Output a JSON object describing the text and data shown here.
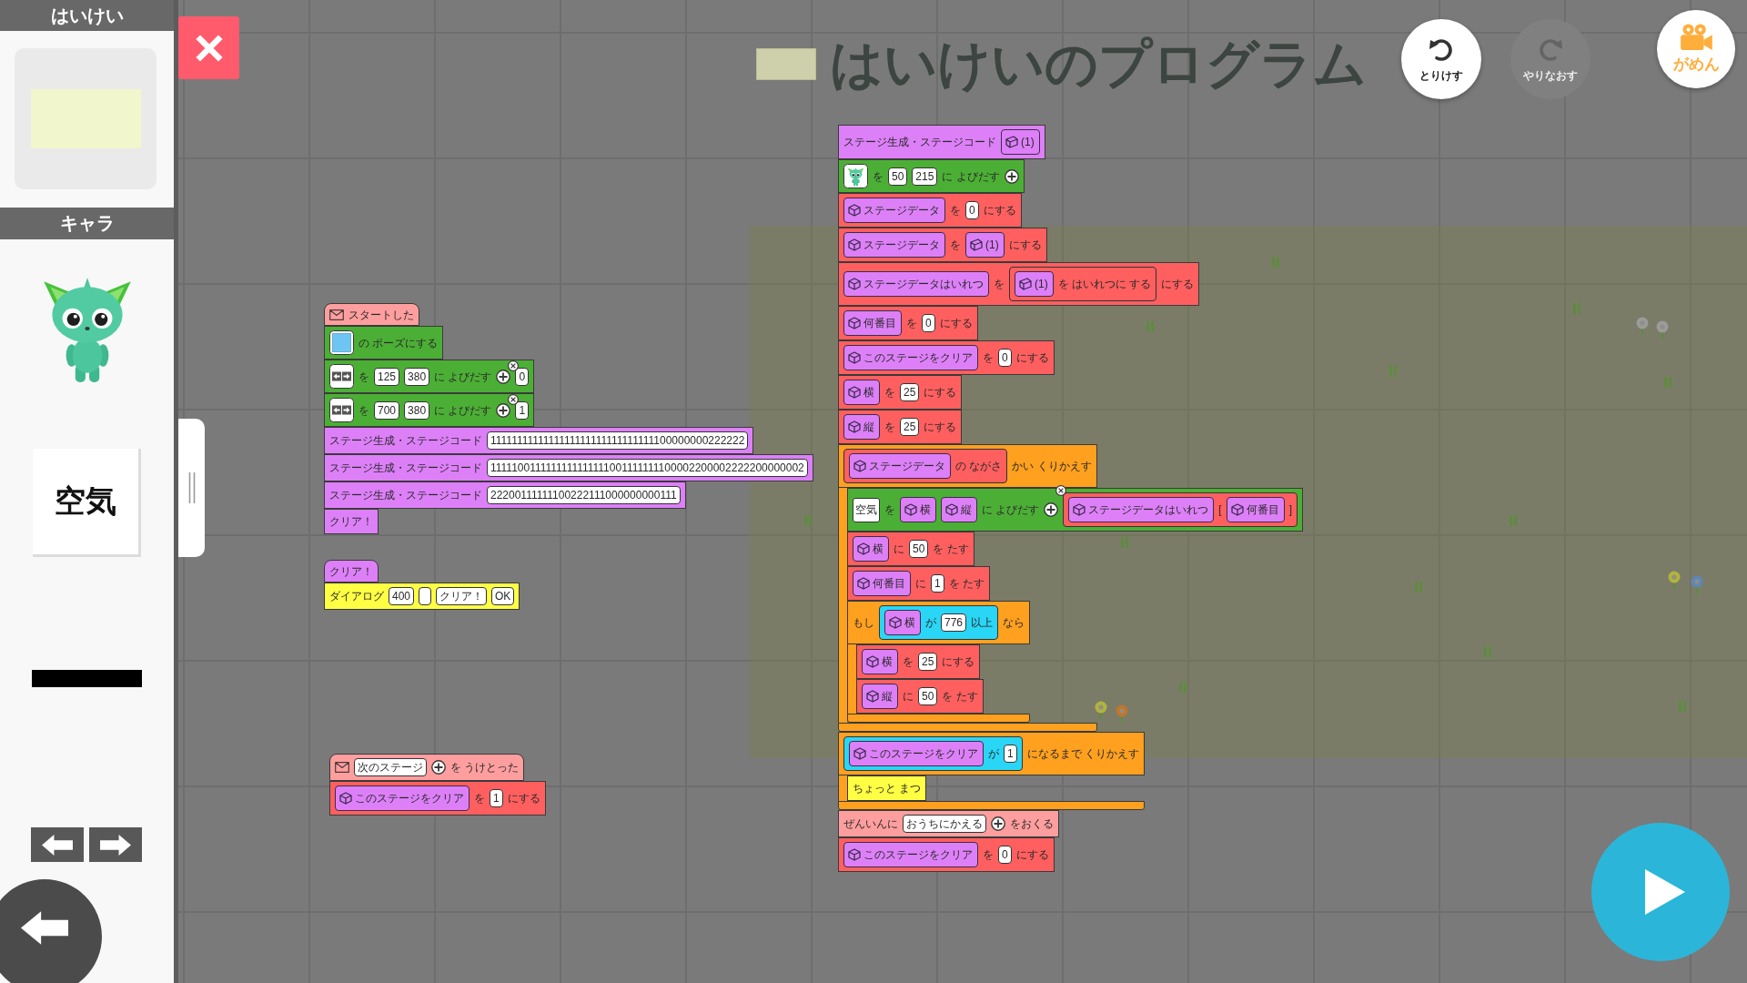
{
  "sidebar": {
    "background": {
      "title": "はいけい"
    },
    "characters": {
      "title": "キャラ",
      "items": [
        {
          "kind": "character"
        },
        {
          "kind": "word",
          "text": "空気"
        },
        {
          "kind": "line"
        }
      ]
    }
  },
  "toolbar": {
    "title": "はいけいのプログラム",
    "buttons": [
      {
        "kind": "undo",
        "label": "とりけす",
        "disabled": false
      },
      {
        "kind": "redo",
        "label": "やりなおす",
        "disabled": true
      }
    ],
    "screen_button": {
      "label": "がめん"
    }
  },
  "scripts": [
    {
      "blocks": [
        {
          "kind": "event",
          "hat": true,
          "parts": [
            {
              "kind": "mail"
            },
            {
              "kind": "text",
              "text": "スタートした"
            }
          ]
        },
        {
          "kind": "sprite",
          "hat": false,
          "parts": [
            {
              "kind": "swatch"
            },
            {
              "kind": "text",
              "text": "の ポーズにする"
            }
          ]
        },
        {
          "kind": "sprite",
          "hat": false,
          "parts": [
            {
              "kind": "arrows"
            },
            {
              "kind": "text",
              "text": "を"
            },
            {
              "kind": "input",
              "value": "125"
            },
            {
              "kind": "input",
              "value": "380"
            },
            {
              "kind": "text",
              "text": "に よびだす"
            },
            {
              "kind": "add"
            },
            {
              "kind": "removable",
              "item": {
                "kind": "input",
                "value": "0"
              }
            }
          ]
        },
        {
          "kind": "sprite",
          "hat": false,
          "parts": [
            {
              "kind": "arrows"
            },
            {
              "kind": "text",
              "text": "を"
            },
            {
              "kind": "input",
              "value": "700"
            },
            {
              "kind": "input",
              "value": "380"
            },
            {
              "kind": "text",
              "text": "に よびだす"
            },
            {
              "kind": "add"
            },
            {
              "kind": "removable",
              "item": {
                "kind": "input",
                "value": "1"
              }
            }
          ]
        },
        {
          "kind": "stage",
          "hat": false,
          "parts": [
            {
              "kind": "text",
              "text": "ステージ生成・ステージコード"
            },
            {
              "kind": "input",
              "value": "1111111111111111111111111111111100000000222222"
            }
          ]
        },
        {
          "kind": "stage",
          "hat": false,
          "parts": [
            {
              "kind": "text",
              "text": "ステージ生成・ステージコード"
            },
            {
              "kind": "input",
              "value": "1111100111111111111111001111111100002200002222200000002"
            }
          ]
        },
        {
          "kind": "stage",
          "hat": false,
          "parts": [
            {
              "kind": "text",
              "text": "ステージ生成・ステージコード"
            },
            {
              "kind": "input",
              "value": "22200111111100222111000000000111"
            }
          ]
        },
        {
          "kind": "stage",
          "hat": false,
          "parts": [
            {
              "kind": "text",
              "text": "クリア！"
            }
          ]
        }
      ]
    },
    {
      "blocks": [
        {
          "kind": "stage",
          "hat": true,
          "parts": [
            {
              "kind": "text",
              "text": "クリア！"
            }
          ]
        },
        {
          "kind": "dialog",
          "hat": false,
          "parts": [
            {
              "kind": "text",
              "text": "ダイアログ"
            },
            {
              "kind": "input",
              "value": "400"
            },
            {
              "kind": "input"
            },
            {
              "kind": "input",
              "value": "クリア！"
            },
            {
              "kind": "input",
              "value": "OK"
            }
          ]
        }
      ]
    },
    {
      "blocks": [
        {
          "kind": "event",
          "hat": true,
          "parts": [
            {
              "kind": "mail"
            },
            {
              "kind": "input",
              "value": "次のステージ"
            },
            {
              "kind": "add"
            },
            {
              "kind": "text",
              "text": "を うけとった"
            }
          ]
        },
        {
          "kind": "variable",
          "hat": false,
          "parts": [
            {
              "kind": "variable",
              "name": "このステージをクリア"
            },
            {
              "kind": "text",
              "text": "を"
            },
            {
              "kind": "input",
              "value": "1"
            },
            {
              "kind": "text",
              "text": "にする"
            }
          ]
        }
      ]
    },
    {
      "blocks": [
        {
          "kind": "stage",
          "hat": false,
          "parts": [
            {
              "kind": "text",
              "text": "ステージ生成・ステージコード"
            },
            {
              "kind": "argument",
              "name": "(1)"
            }
          ]
        },
        {
          "kind": "sprite",
          "hat": false,
          "parts": [
            {
              "kind": "character"
            },
            {
              "kind": "text",
              "text": "を"
            },
            {
              "kind": "input",
              "value": "50"
            },
            {
              "kind": "input",
              "value": "215"
            },
            {
              "kind": "text",
              "text": "に よびだす"
            },
            {
              "kind": "add"
            }
          ]
        },
        {
          "kind": "variable",
          "hat": false,
          "parts": [
            {
              "kind": "variable",
              "name": "ステージデータ"
            },
            {
              "kind": "text",
              "text": "を"
            },
            {
              "kind": "input",
              "value": "0"
            },
            {
              "kind": "text",
              "text": "にする"
            }
          ]
        },
        {
          "kind": "variable",
          "hat": false,
          "parts": [
            {
              "kind": "variable",
              "name": "ステージデータ"
            },
            {
              "kind": "text",
              "text": "を"
            },
            {
              "kind": "argument",
              "name": "(1)"
            },
            {
              "kind": "text",
              "text": "にする"
            }
          ]
        },
        {
          "kind": "variable",
          "hat": false,
          "parts": [
            {
              "kind": "variable",
              "name": "ステージデータはいれつ"
            },
            {
              "kind": "text",
              "text": "を"
            },
            {
              "kind": "reporter",
              "parts": [
                {
                  "kind": "argument",
                  "name": "(1)"
                },
                {
                  "kind": "text",
                  "text": "を はいれつに する"
                }
              ]
            },
            {
              "kind": "text",
              "text": "にする"
            }
          ]
        },
        {
          "kind": "variable",
          "hat": false,
          "parts": [
            {
              "kind": "variable",
              "name": "何番目"
            },
            {
              "kind": "text",
              "text": "を"
            },
            {
              "kind": "input",
              "value": "0"
            },
            {
              "kind": "text",
              "text": "にする"
            }
          ]
        },
        {
          "kind": "variable",
          "hat": false,
          "parts": [
            {
              "kind": "variable",
              "name": "このステージをクリア"
            },
            {
              "kind": "text",
              "text": "を"
            },
            {
              "kind": "input",
              "value": "0"
            },
            {
              "kind": "text",
              "text": "にする"
            }
          ]
        },
        {
          "kind": "variable",
          "hat": false,
          "parts": [
            {
              "kind": "variable",
              "name": "横"
            },
            {
              "kind": "text",
              "text": "を"
            },
            {
              "kind": "input",
              "value": "25"
            },
            {
              "kind": "text",
              "text": "にする"
            }
          ]
        },
        {
          "kind": "variable",
          "hat": false,
          "parts": [
            {
              "kind": "variable",
              "name": "縦"
            },
            {
              "kind": "text",
              "text": "を"
            },
            {
              "kind": "input",
              "value": "25"
            },
            {
              "kind": "text",
              "text": "にする"
            }
          ]
        },
        {
          "kind": "control",
          "hat": false,
          "parts": [
            {
              "kind": "reporter",
              "parts": [
                {
                  "kind": "variable",
                  "name": "ステージデータ"
                },
                {
                  "kind": "text",
                  "text": "の ながさ"
                }
              ]
            },
            {
              "kind": "text",
              "text": "かい くりかえす"
            }
          ],
          "body": [
            {
              "kind": "sprite",
              "hat": false,
              "parts": [
                {
                  "kind": "tile",
                  "text": "空気"
                },
                {
                  "kind": "text",
                  "text": "を"
                },
                {
                  "kind": "variable",
                  "name": "横"
                },
                {
                  "kind": "variable",
                  "name": "縦"
                },
                {
                  "kind": "text",
                  "text": "に よびだす"
                },
                {
                  "kind": "add"
                },
                {
                  "kind": "removable",
                  "item": {
                    "kind": "reporter",
                    "parts": [
                      {
                        "kind": "variable",
                        "name": "ステージデータはいれつ"
                      },
                      {
                        "kind": "text",
                        "text": "["
                      },
                      {
                        "kind": "variable",
                        "name": "何番目"
                      },
                      {
                        "kind": "text",
                        "text": "]"
                      }
                    ]
                  }
                }
              ]
            },
            {
              "kind": "variable",
              "hat": false,
              "parts": [
                {
                  "kind": "variable",
                  "name": "横"
                },
                {
                  "kind": "text",
                  "text": "に"
                },
                {
                  "kind": "input",
                  "value": "50"
                },
                {
                  "kind": "text",
                  "text": "を たす"
                }
              ]
            },
            {
              "kind": "variable",
              "hat": false,
              "parts": [
                {
                  "kind": "variable",
                  "name": "何番目"
                },
                {
                  "kind": "text",
                  "text": "に"
                },
                {
                  "kind": "input",
                  "value": "1"
                },
                {
                  "kind": "text",
                  "text": "を たす"
                }
              ]
            },
            {
              "kind": "control",
              "hat": false,
              "parts": [
                {
                  "kind": "text",
                  "text": "もし"
                },
                {
                  "kind": "condition",
                  "parts": [
                    {
                      "kind": "variable",
                      "name": "横"
                    },
                    {
                      "kind": "text",
                      "text": "が"
                    },
                    {
                      "kind": "input",
                      "value": "776"
                    },
                    {
                      "kind": "text",
                      "text": "以上"
                    }
                  ]
                },
                {
                  "kind": "text",
                  "text": "なら"
                }
              ],
              "body": [
                {
                  "kind": "variable",
                  "hat": false,
                  "parts": [
                    {
                      "kind": "variable",
                      "name": "横"
                    },
                    {
                      "kind": "text",
                      "text": "を"
                    },
                    {
                      "kind": "input",
                      "value": "25"
                    },
                    {
                      "kind": "text",
                      "text": "にする"
                    }
                  ]
                },
                {
                  "kind": "variable",
                  "hat": false,
                  "parts": [
                    {
                      "kind": "variable",
                      "name": "縦"
                    },
                    {
                      "kind": "text",
                      "text": "に"
                    },
                    {
                      "kind": "input",
                      "value": "50"
                    },
                    {
                      "kind": "text",
                      "text": "を たす"
                    }
                  ]
                }
              ]
            }
          ]
        },
        {
          "kind": "control",
          "hat": false,
          "parts": [
            {
              "kind": "condition",
              "parts": [
                {
                  "kind": "variable",
                  "name": "このステージをクリア"
                },
                {
                  "kind": "text",
                  "text": "が"
                },
                {
                  "kind": "input",
                  "value": "1"
                }
              ]
            },
            {
              "kind": "text",
              "text": "になるまで くりかえす"
            }
          ],
          "body": [
            {
              "kind": "dialog",
              "hat": false,
              "parts": [
                {
                  "kind": "text",
                  "text": "ちょっと まつ"
                }
              ]
            }
          ]
        },
        {
          "kind": "event",
          "hat": false,
          "parts": [
            {
              "kind": "text",
              "text": "ぜんいんに"
            },
            {
              "kind": "input",
              "value": "おうちにかえる"
            },
            {
              "kind": "add"
            },
            {
              "kind": "text",
              "text": "をおくる"
            }
          ]
        },
        {
          "kind": "variable",
          "hat": false,
          "parts": [
            {
              "kind": "variable",
              "name": "このステージをクリア"
            },
            {
              "kind": "text",
              "text": "を"
            },
            {
              "kind": "input",
              "value": "0"
            },
            {
              "kind": "text",
              "text": "にする"
            }
          ]
        }
      ]
    }
  ]
}
